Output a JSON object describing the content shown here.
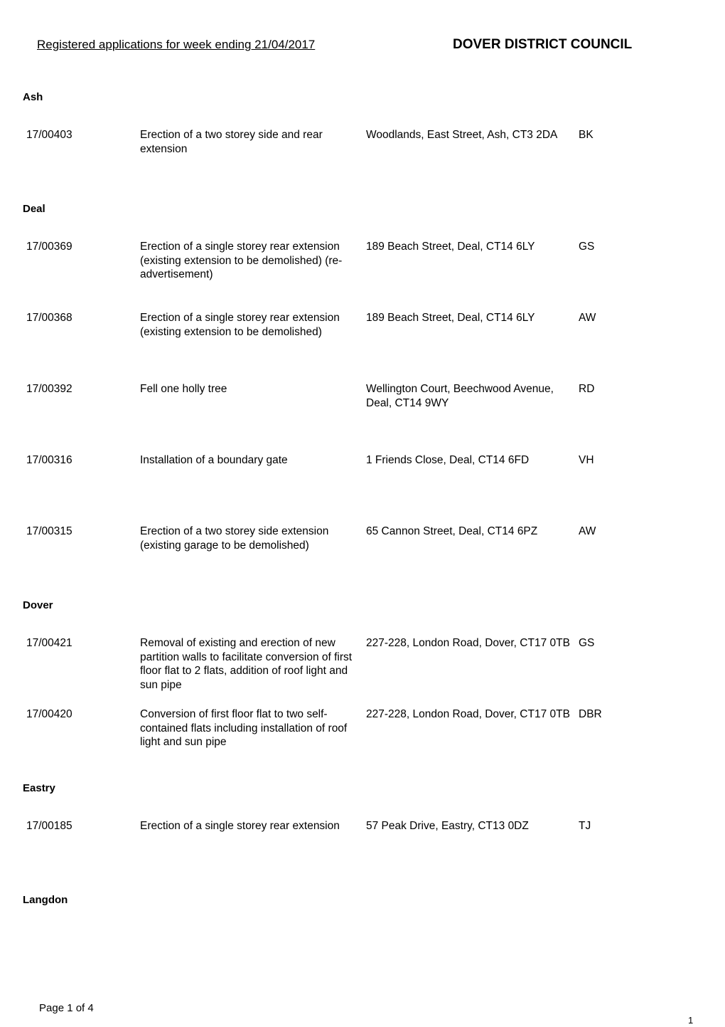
{
  "header": {
    "title": "Registered applications for week ending 21/04/2017",
    "council": "DOVER DISTRICT COUNCIL"
  },
  "sections": [
    {
      "name": "Ash",
      "rows": [
        {
          "ref": "17/00403",
          "description": "Erection of a two storey side and rear extension",
          "address": "Woodlands, East Street, Ash, CT3 2DA",
          "officer": "BK"
        }
      ]
    },
    {
      "name": "Deal",
      "rows": [
        {
          "ref": "17/00369",
          "description": "Erection of a single storey rear extension (existing extension to be demolished) (re-advertisement)",
          "address": "189 Beach Street, Deal, CT14 6LY",
          "officer": "GS"
        },
        {
          "ref": "17/00368",
          "description": "Erection of a single storey rear extension (existing extension to be demolished)",
          "address": "189 Beach Street, Deal, CT14 6LY",
          "officer": "AW"
        },
        {
          "ref": "17/00392",
          "description": "Fell one holly tree",
          "address": "Wellington Court, Beechwood Avenue, Deal, CT14 9WY",
          "officer": "RD"
        },
        {
          "ref": "17/00316",
          "description": "Installation of a boundary gate",
          "address": "1 Friends Close, Deal, CT14 6FD",
          "officer": "VH"
        },
        {
          "ref": "17/00315",
          "description": "Erection of a two storey side extension (existing garage to be demolished)",
          "address": "65 Cannon Street, Deal, CT14 6PZ",
          "officer": "AW"
        }
      ]
    },
    {
      "name": "Dover",
      "rows": [
        {
          "ref": "17/00421",
          "description": "Removal of existing and erection of new partition walls to facilitate conversion of first floor flat to 2 flats, addition of roof light and sun pipe",
          "address": "227-228, London Road, Dover, CT17 0TB",
          "officer": "GS"
        },
        {
          "ref": "17/00420",
          "description": "Conversion of first floor flat to two self-contained flats including installation of roof light and sun pipe",
          "address": "227-228, London Road, Dover, CT17 0TB",
          "officer": "DBR"
        }
      ]
    },
    {
      "name": "Eastry",
      "rows": [
        {
          "ref": "17/00185",
          "description": "Erection of a single storey rear extension",
          "address": "57 Peak Drive, Eastry, CT13 0DZ",
          "officer": "TJ"
        }
      ]
    },
    {
      "name": "Langdon",
      "rows": []
    }
  ],
  "footer": {
    "page_label": "Page 1 of 4",
    "page_number": "1"
  }
}
